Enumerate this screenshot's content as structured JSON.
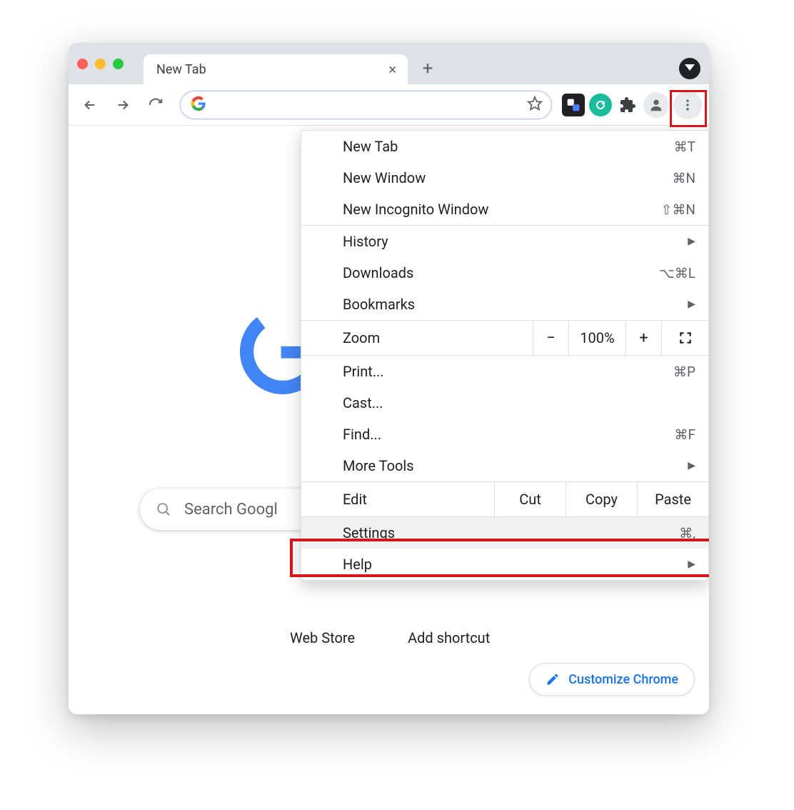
{
  "tab": {
    "title": "New Tab"
  },
  "omnibox": {
    "placeholder": ""
  },
  "search": {
    "placeholder": "Search Google or type a URL",
    "visible_text": "Search Googl"
  },
  "shortcuts": {
    "web_store": "Web Store",
    "add_shortcut": "Add shortcut"
  },
  "customize": {
    "label": "Customize Chrome"
  },
  "menu": {
    "new_tab": {
      "label": "New Tab",
      "shortcut": "⌘T"
    },
    "new_window": {
      "label": "New Window",
      "shortcut": "⌘N"
    },
    "incognito": {
      "label": "New Incognito Window",
      "shortcut": "⇧⌘N"
    },
    "history": {
      "label": "History"
    },
    "downloads": {
      "label": "Downloads",
      "shortcut": "⌥⌘L"
    },
    "bookmarks": {
      "label": "Bookmarks"
    },
    "zoom": {
      "label": "Zoom",
      "value": "100%"
    },
    "print": {
      "label": "Print...",
      "shortcut": "⌘P"
    },
    "cast": {
      "label": "Cast..."
    },
    "find": {
      "label": "Find...",
      "shortcut": "⌘F"
    },
    "more_tools": {
      "label": "More Tools"
    },
    "edit": {
      "label": "Edit",
      "cut": "Cut",
      "copy": "Copy",
      "paste": "Paste"
    },
    "settings": {
      "label": "Settings",
      "shortcut": "⌘,"
    },
    "help": {
      "label": "Help"
    }
  }
}
